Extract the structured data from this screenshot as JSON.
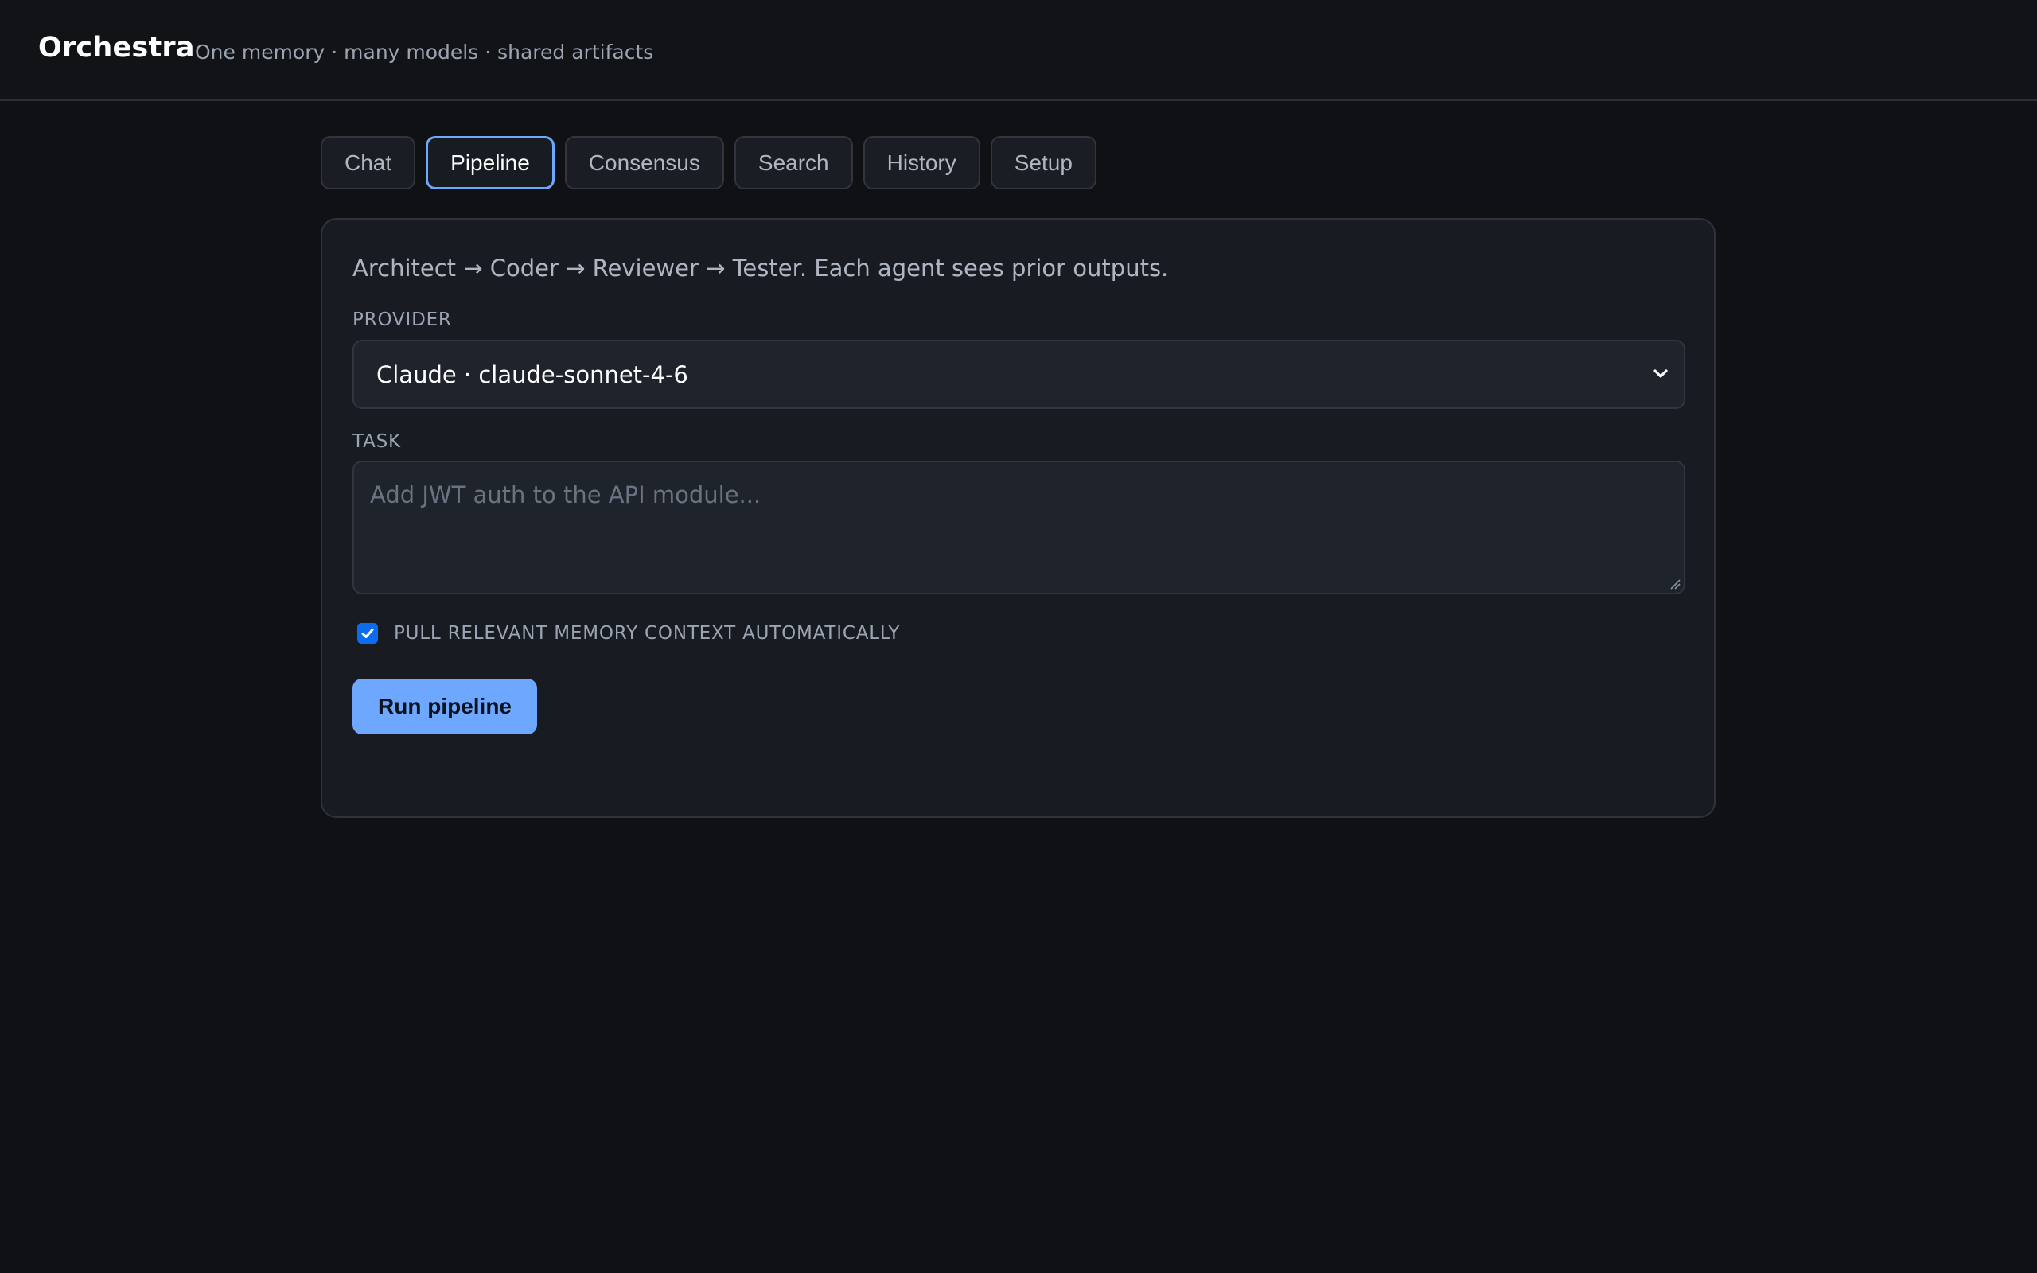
{
  "app": {
    "title": "Orchestra",
    "tagline": "One memory · many models · shared artifacts"
  },
  "tabs": [
    {
      "label": "Chat",
      "active": false
    },
    {
      "label": "Pipeline",
      "active": true
    },
    {
      "label": "Consensus",
      "active": false
    },
    {
      "label": "Search",
      "active": false
    },
    {
      "label": "History",
      "active": false
    },
    {
      "label": "Setup",
      "active": false
    }
  ],
  "pipeline": {
    "description": "Architect → Coder → Reviewer → Tester. Each agent sees prior outputs.",
    "provider_label": "PROVIDER",
    "provider_value": "Claude · claude-sonnet-4-6",
    "task_label": "TASK",
    "task_placeholder": "Add JWT auth to the API module...",
    "task_value": "",
    "memory_checkbox_label": "PULL RELEVANT MEMORY CONTEXT AUTOMATICALLY",
    "memory_checkbox_checked": true,
    "run_button_label": "Run pipeline"
  },
  "icons": {
    "select_chevron": "chevron-down-icon",
    "checkbox_mark": "check-icon",
    "resize_grip": "resize-grip-icon"
  },
  "colors": {
    "background": "#0f1115",
    "panel": "#181b22",
    "accent": "#6ea8fe",
    "checkbox": "#0b6cf0"
  }
}
